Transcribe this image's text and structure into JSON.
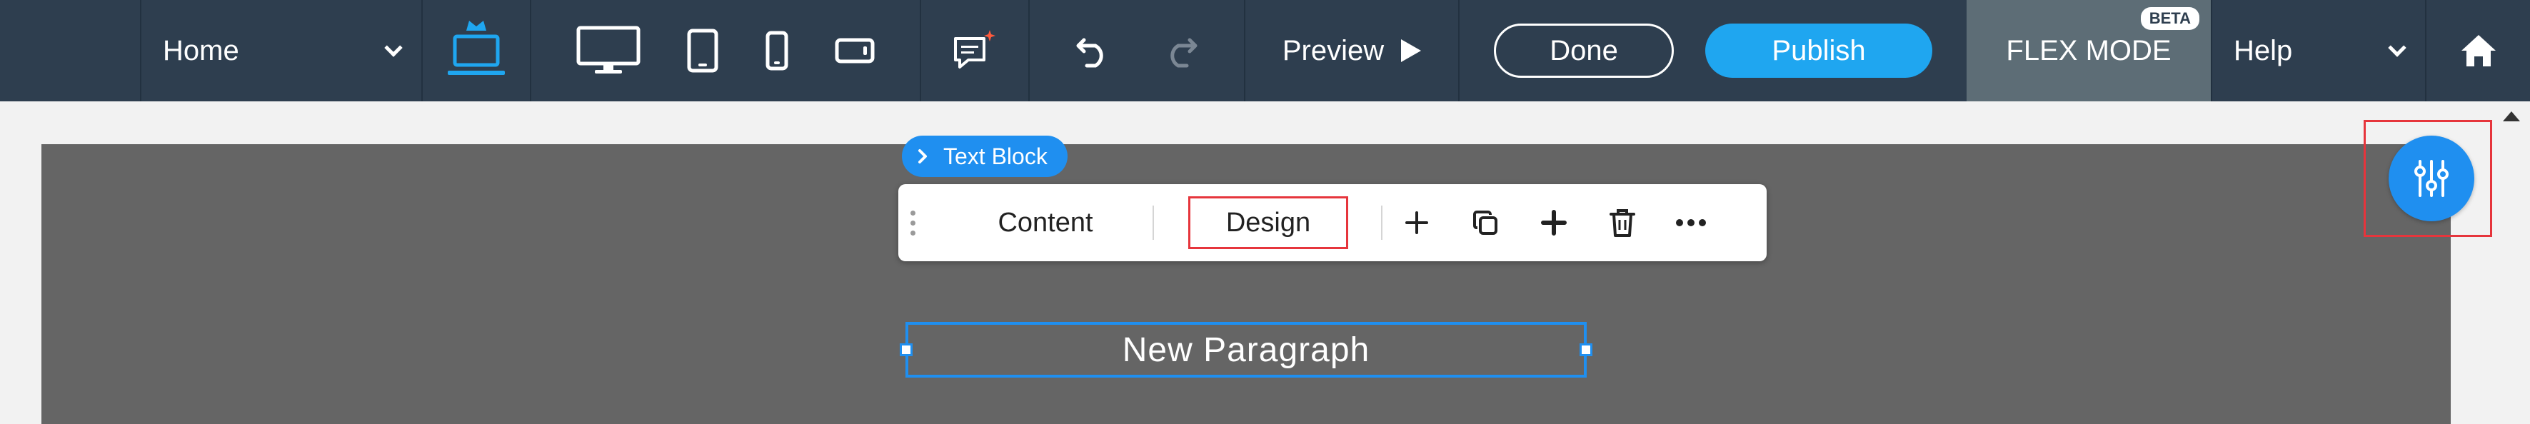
{
  "topbar": {
    "page_select": {
      "label": "Home",
      "icon": "chevron-down-icon"
    },
    "devices": {
      "laptop_icon": "laptop-crown-icon",
      "desktop_icon": "desktop-icon",
      "tablet_icon": "tablet-icon",
      "mobile_icon": "mobile-icon",
      "landscape_icon": "mobile-landscape-icon"
    },
    "comments_icon": "comment-icon",
    "undo_icon": "undo-icon",
    "redo_icon": "redo-icon",
    "preview_label": "Preview",
    "done_label": "Done",
    "publish_label": "Publish",
    "flex_mode_label": "FLEX MODE",
    "flex_badge": "BETA",
    "help_label": "Help",
    "home_icon": "home-icon"
  },
  "editor": {
    "breadcrumb_label": "Text Block",
    "tabs": {
      "content": "Content",
      "design": "Design"
    },
    "tools": [
      "add-icon",
      "duplicate-icon",
      "move-icon",
      "delete-icon",
      "more-icon"
    ],
    "paragraph_text": "New Paragraph",
    "settings_icon": "sliders-icon"
  },
  "colors": {
    "topbar_bg": "#2e3e4f",
    "accent": "#1f8ff0",
    "publish_bg": "#1fa6f0",
    "highlight": "#e6353c",
    "stage_bg": "#656565",
    "flex_bg": "#5d6d76"
  }
}
